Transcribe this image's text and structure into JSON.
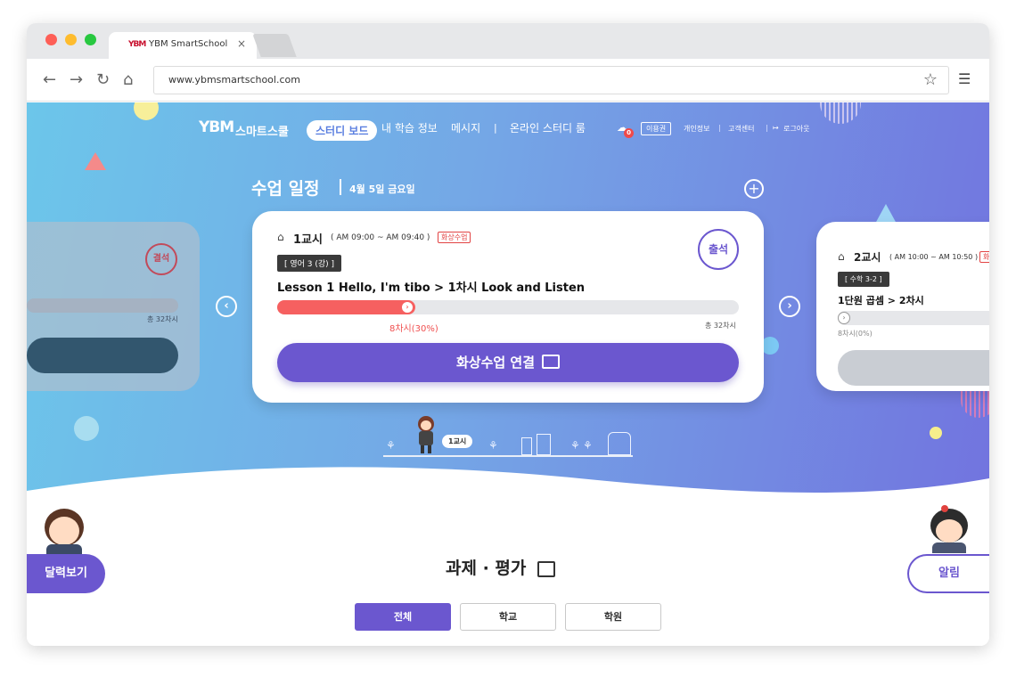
{
  "browser": {
    "tab_title": "YBM SmartSchool",
    "tab_favicon": "YBM",
    "tab_close": "×",
    "url": "www.ybmsmartschool.com"
  },
  "header": {
    "logo_mark": "YBM",
    "logo_text": "스마트스쿨",
    "nav": [
      "스터디 보드",
      "내 학습 정보",
      "메시지",
      "온라인 스터디 룸"
    ],
    "notification_count": "0",
    "pass": "이용권",
    "util": [
      "개인정보",
      "고객센터",
      "로그아웃"
    ]
  },
  "schedule": {
    "title": "수업 일정",
    "date": "4월 5일 금요일"
  },
  "prev_card": {
    "status": "결석",
    "total": "총 32차시"
  },
  "main_card": {
    "period": "1교시",
    "time": "( AM 09:00 ~ AM 09:40 )",
    "tag": "화상수업",
    "subject": "[ 영어 3 (강) ]",
    "lesson": "Lesson 1   Hello, I'm tibo  >  1차시 Look and Listen",
    "progress": 0.3,
    "progress_text": "8차시(30%)",
    "total": "총 32차시",
    "attend": "출석",
    "button": "화상수업 연결"
  },
  "next_card": {
    "period": "2교시",
    "time": "( AM 10:00 ~ AM 10:50 )",
    "tag": "화",
    "subject": "[ 수학 3-2 ]",
    "lesson": "1단원 곱셈 > 2차시",
    "progress": 0,
    "progress_text": "8차시(0%)"
  },
  "timeline": {
    "badge": "1교시"
  },
  "sidebar": {
    "calendar": "달력보기",
    "alarm": "알림"
  },
  "assignments": {
    "title": "과제 · 평가",
    "filters": [
      "전체",
      "학교",
      "학원"
    ]
  },
  "colors": {
    "accent": "#6b57cf",
    "progress": "#f66060",
    "hero_start": "#6cc6ea",
    "hero_end": "#7274df"
  }
}
